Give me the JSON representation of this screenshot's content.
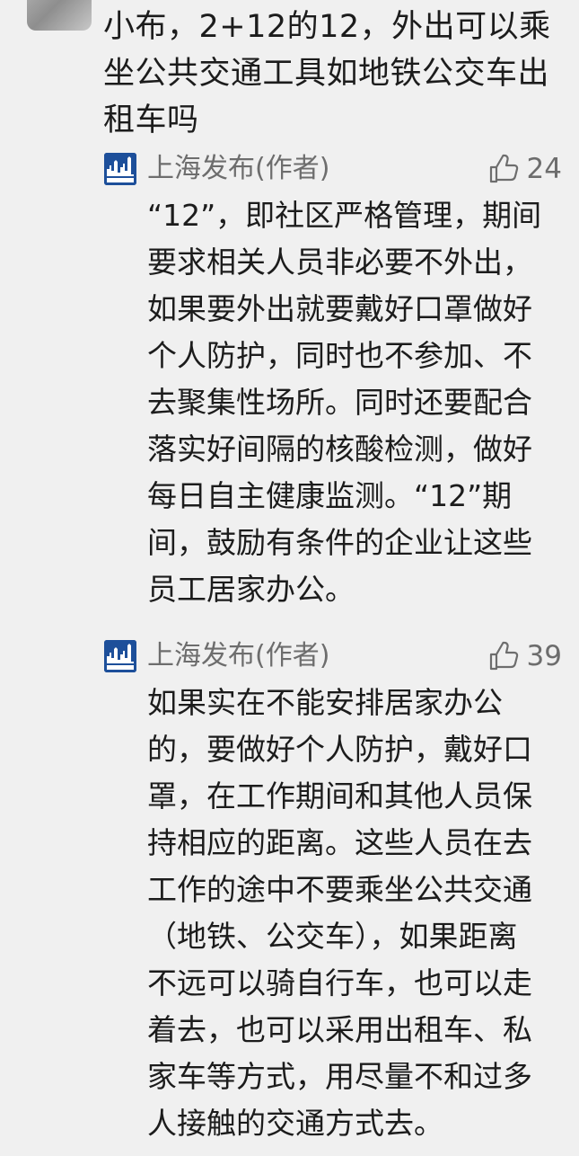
{
  "question": {
    "text": "小布，2+12的12，外出可以乘坐公共交通工具如地铁公交车出租车吗"
  },
  "replies": [
    {
      "author": "上海发布(作者)",
      "logo_text": "上海发布",
      "likes": "24",
      "text": "“12”，即社区严格管理，期间要求相关人员非必要不外出，如果要外出就要戴好口罩做好个人防护，同时也不参加、不去聚集性场所。同时还要配合落实好间隔的核酸检测，做好每日自主健康监测。“12”期间，鼓励有条件的企业让这些员工居家办公。"
    },
    {
      "author": "上海发布(作者)",
      "logo_text": "上海发布",
      "likes": "39",
      "text": "如果实在不能安排居家办公的，要做好个人防护，戴好口罩，在工作期间和其他人员保持相应的距离。这些人员在去工作的途中不要乘坐公共交通（地铁、公交车），如果距离不远可以骑自行车，也可以走着去，也可以采用出租车、私家车等方式，用尽量不和过多人接触的交通方式去。"
    }
  ],
  "colors": {
    "background": "#f0f0f0",
    "text": "#1c1c1c",
    "muted": "#6d6d6d",
    "brand": "#1d4f9a"
  },
  "icons": {
    "like": "thumbs-up-icon",
    "logo": "shanghai-skyline-logo"
  }
}
